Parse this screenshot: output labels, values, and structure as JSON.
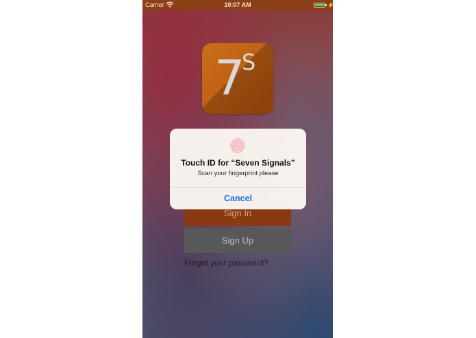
{
  "status_bar": {
    "carrier": "Carrier",
    "time": "10:07 AM",
    "battery_color": "#4cd964",
    "wifi_icon": "wifi-icon",
    "bolt_icon": "charging-bolt-icon"
  },
  "logo": {
    "number": "7",
    "letter": "S",
    "color": "#c2600f"
  },
  "login": {
    "sign_in_label": "Sign In",
    "sign_up_label": "Sign Up",
    "forgot_label": "Forget your password?"
  },
  "alert": {
    "title": "Touch ID for “Seven Signals”",
    "message": "Scan your fingerprint please",
    "cancel_label": "Cancel",
    "icon": "fingerprint-icon",
    "accent": "#1d6fe0"
  }
}
